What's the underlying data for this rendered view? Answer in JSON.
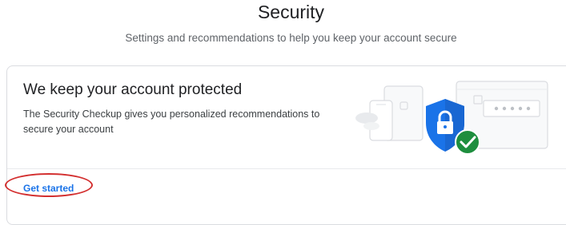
{
  "header": {
    "title": "Security",
    "subtitle": "Settings and recommendations to help you keep your account secure"
  },
  "security_checkup_card": {
    "title": "We keep your account protected",
    "description": "The Security Checkup gives you personalized recommendations to secure your account",
    "cta_label": "Get started",
    "illustration_icons": [
      "devices-icon",
      "shield-lock-icon",
      "check-circle-icon",
      "password-field-icon"
    ]
  },
  "colors": {
    "accent": "#1a73e8",
    "shield": "#1a73e8",
    "check": "#1e8e3e",
    "annotation": "#d32f2f"
  }
}
